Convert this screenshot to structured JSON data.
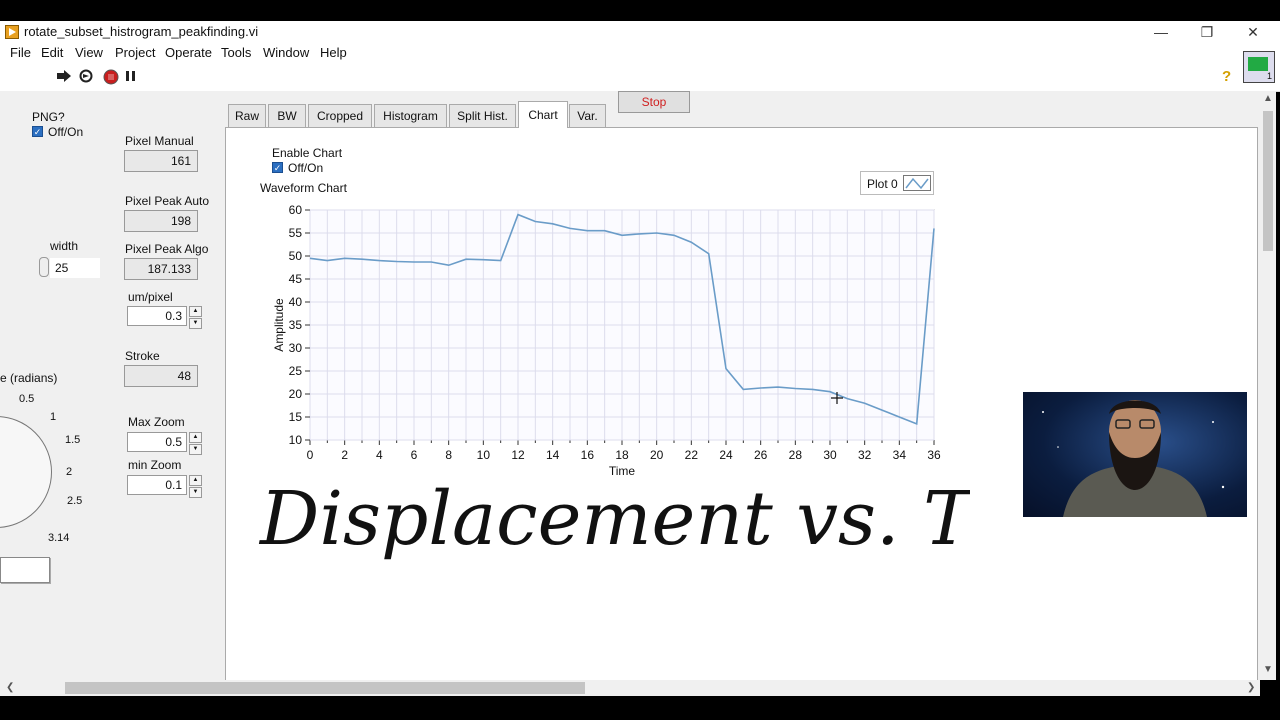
{
  "window": {
    "title": "rotate_subset_histrogram_peakfinding.vi",
    "minimize": "—",
    "restore": "❐",
    "close": "✕"
  },
  "menu": [
    "File",
    "Edit",
    "View",
    "Project",
    "Operate",
    "Tools",
    "Window",
    "Help"
  ],
  "toolbar": {
    "icons": [
      "run-arrow-icon",
      "run-continuous-icon",
      "abort-icon",
      "pause-icon"
    ],
    "help": "?",
    "vi_num": "1"
  },
  "controls": {
    "png_label": "PNG?",
    "png_toggle": "Off/On",
    "width_label": "width",
    "width_value": "25",
    "angle_label": "e (radians)",
    "dial_marks": [
      "0.5",
      "1",
      "1.5",
      "2",
      "2.5",
      "3.14"
    ]
  },
  "indicators": {
    "pixel_manual_label": "Pixel Manual",
    "pixel_manual": "161",
    "pixel_peak_auto_label": "Pixel Peak Auto",
    "pixel_peak_auto": "198",
    "pixel_peak_algo_label": "Pixel Peak Algo",
    "pixel_peak_algo": "187.133",
    "um_pixel_label": "um/pixel",
    "um_pixel": "0.3",
    "stroke_label": "Stroke",
    "stroke": "48",
    "max_zoom_label": "Max Zoom",
    "max_zoom": "0.5",
    "min_zoom_label": "min Zoom",
    "min_zoom": "0.1"
  },
  "tabs": [
    {
      "label": "Raw",
      "active": false
    },
    {
      "label": "BW",
      "active": false
    },
    {
      "label": "Cropped",
      "active": false
    },
    {
      "label": "Histogram",
      "active": false
    },
    {
      "label": "Split Hist.",
      "active": false
    },
    {
      "label": "Chart",
      "active": true
    },
    {
      "label": "Var.",
      "active": false
    }
  ],
  "stop_button": "Stop",
  "chart_tab": {
    "enable_label": "Enable Chart",
    "enable_toggle": "Off/On"
  },
  "chart_data": {
    "type": "line",
    "title": "Waveform Chart",
    "xlabel": "Time",
    "ylabel": "Amplitude",
    "xlim": [
      0,
      36
    ],
    "ylim": [
      10,
      60
    ],
    "xticks": [
      0,
      2,
      4,
      6,
      8,
      10,
      12,
      14,
      16,
      18,
      20,
      22,
      24,
      26,
      28,
      30,
      32,
      34,
      36
    ],
    "yticks": [
      10,
      15,
      20,
      25,
      30,
      35,
      40,
      45,
      50,
      55,
      60
    ],
    "grid": true,
    "legend": "top-right",
    "series": [
      {
        "name": "Plot 0",
        "color": "#6a9cc8",
        "x": [
          0,
          1,
          2,
          3,
          4,
          5,
          6,
          7,
          8,
          9,
          10,
          11,
          12,
          13,
          14,
          15,
          16,
          17,
          18,
          19,
          20,
          21,
          22,
          23,
          24,
          25,
          26,
          27,
          28,
          29,
          30,
          31,
          32,
          33,
          34,
          35,
          36
        ],
        "values": [
          49.5,
          49,
          49.5,
          49.3,
          49,
          48.8,
          48.7,
          48.7,
          48,
          49.3,
          49.2,
          49,
          59,
          57.5,
          57,
          56,
          55.5,
          55.5,
          54.5,
          54.8,
          55,
          54.5,
          53,
          50.5,
          25.5,
          21,
          21.3,
          21.5,
          21.2,
          21,
          20.5,
          19,
          18,
          16.5,
          15,
          13.5,
          56
        ]
      }
    ]
  },
  "handwriting": "Displacement vs. Time"
}
